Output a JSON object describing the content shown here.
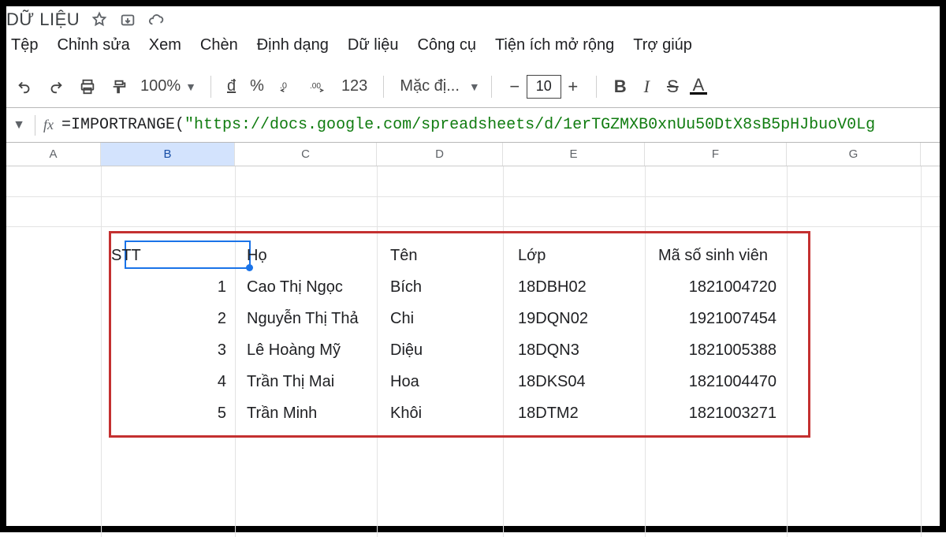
{
  "title": "DỮ LIỆU",
  "menus": [
    "Tệp",
    "Chỉnh sửa",
    "Xem",
    "Chèn",
    "Định dạng",
    "Dữ liệu",
    "Công cụ",
    "Tiện ích mở rộng",
    "Trợ giúp"
  ],
  "toolbar": {
    "zoom": "100%",
    "currency": "đ",
    "percent": "%",
    "dec_dec": ".0",
    "inc_dec": ".00",
    "num123": "123",
    "font": "Mặc đị...",
    "size": "10",
    "bold": "B",
    "italic": "I",
    "strike": "S",
    "colorA": "A"
  },
  "formula": {
    "fn": "=IMPORTRANGE(",
    "arg": "\"https://docs.google.com/spreadsheets/d/1erTGZMXB0xnUu50DtX8sB5pHJbuoV0Lg"
  },
  "columns": [
    "A",
    "B",
    "C",
    "D",
    "E",
    "F",
    "G"
  ],
  "headers": {
    "stt": "STT",
    "ho": "Họ",
    "ten": "Tên",
    "lop": "Lớp",
    "msv": "Mã số sinh viên"
  },
  "rows": [
    {
      "stt": "1",
      "ho": "Cao Thị Ngọc",
      "ten": "Bích",
      "lop": "18DBH02",
      "msv": "1821004720"
    },
    {
      "stt": "2",
      "ho": "Nguyễn Thị Thả",
      "ten": "Chi",
      "lop": "19DQN02",
      "msv": "1921007454"
    },
    {
      "stt": "3",
      "ho": "Lê Hoàng Mỹ",
      "ten": "Diệu",
      "lop": "18DQN3",
      "msv": "1821005388"
    },
    {
      "stt": "4",
      "ho": "Trần Thị Mai",
      "ten": "Hoa",
      "lop": "18DKS04",
      "msv": "1821004470"
    },
    {
      "stt": "5",
      "ho": "Trần Minh",
      "ten": "Khôi",
      "lop": "18DTM2",
      "msv": "1821003271"
    }
  ],
  "selected_cell": "B"
}
